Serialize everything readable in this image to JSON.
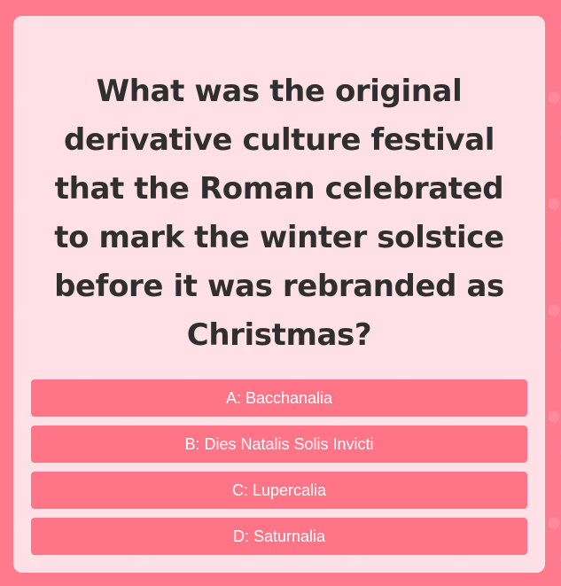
{
  "quiz": {
    "question": "What was the original derivative culture festival that the Roman celebrated to mark the winter solstice before it was rebranded as Christmas?",
    "answers": [
      {
        "label": "A: Bacchanalia"
      },
      {
        "label": "B: Dies Natalis Solis Invicti"
      },
      {
        "label": "C: Lupercalia"
      },
      {
        "label": "D: Saturnalia"
      }
    ]
  },
  "colors": {
    "background": "#ff7a8d",
    "card": "#ffe7ec",
    "button": "#ff7587",
    "button_text": "#ffffff",
    "question_text": "#2f2f2f"
  }
}
